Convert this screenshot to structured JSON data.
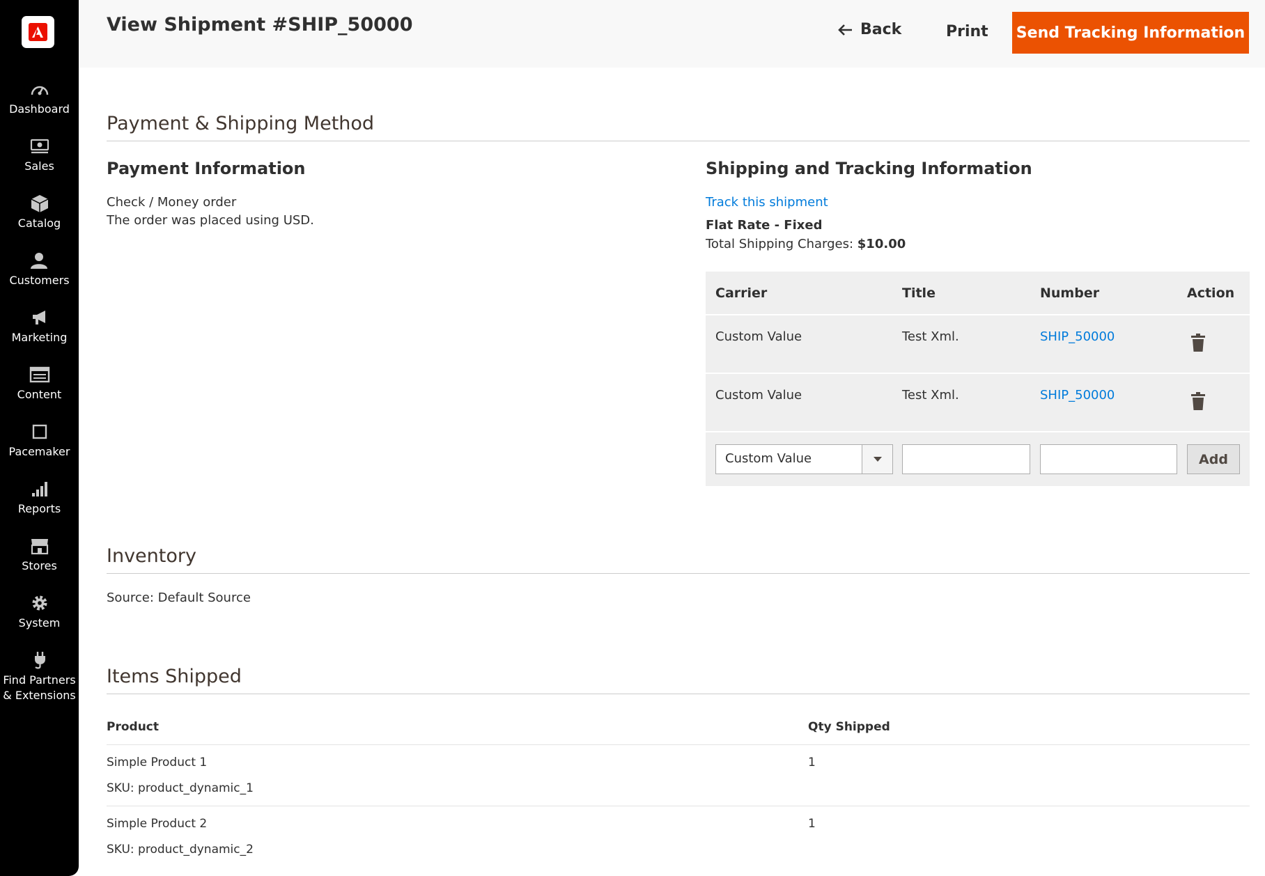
{
  "sidebar": {
    "items": [
      {
        "label": "Dashboard",
        "icon": "dashboard-icon"
      },
      {
        "label": "Sales",
        "icon": "sales-icon"
      },
      {
        "label": "Catalog",
        "icon": "catalog-icon"
      },
      {
        "label": "Customers",
        "icon": "customers-icon"
      },
      {
        "label": "Marketing",
        "icon": "marketing-icon"
      },
      {
        "label": "Content",
        "icon": "content-icon"
      },
      {
        "label": "Pacemaker",
        "icon": "pacemaker-icon"
      },
      {
        "label": "Reports",
        "icon": "reports-icon"
      },
      {
        "label": "Stores",
        "icon": "stores-icon"
      },
      {
        "label": "System",
        "icon": "system-icon"
      },
      {
        "label": "Find Partners",
        "label2": "& Extensions",
        "icon": "extensions-icon"
      }
    ]
  },
  "header": {
    "title": "View Shipment #SHIP_50000",
    "back_label": "Back",
    "print_label": "Print",
    "send_label": "Send Tracking Information"
  },
  "payment_shipping": {
    "section_title": "Payment & Shipping Method",
    "payment": {
      "title": "Payment Information",
      "method": "Check / Money order",
      "currency_note": "The order was placed using USD."
    },
    "shipping": {
      "title": "Shipping and Tracking Information",
      "track_link": "Track this shipment",
      "method": "Flat Rate - Fixed",
      "charges_label": "Total Shipping Charges:",
      "charges_value": "$10.00",
      "table": {
        "headers": [
          "Carrier",
          "Title",
          "Number",
          "Action"
        ],
        "rows": [
          {
            "carrier": "Custom Value",
            "title": "Test Xml.",
            "number": "SHIP_50000"
          },
          {
            "carrier": "Custom Value",
            "title": "Test Xml.",
            "number": "SHIP_50000"
          }
        ],
        "new_row": {
          "carrier_selected": "Custom Value",
          "title_value": "",
          "number_value": "",
          "add_label": "Add"
        }
      }
    }
  },
  "inventory": {
    "section_title": "Inventory",
    "source": "Source: Default Source"
  },
  "items_shipped": {
    "section_title": "Items Shipped",
    "headers": [
      "Product",
      "Qty Shipped"
    ],
    "rows": [
      {
        "name": "Simple Product 1",
        "sku": "SKU: product_dynamic_1",
        "qty": "1"
      },
      {
        "name": "Simple Product 2",
        "sku": "SKU: product_dynamic_2",
        "qty": "1"
      }
    ]
  },
  "colors": {
    "accent": "#eb5202",
    "link": "#007bdb",
    "sidebar_bg": "#000000",
    "header_bg": "#f8f8f8"
  }
}
